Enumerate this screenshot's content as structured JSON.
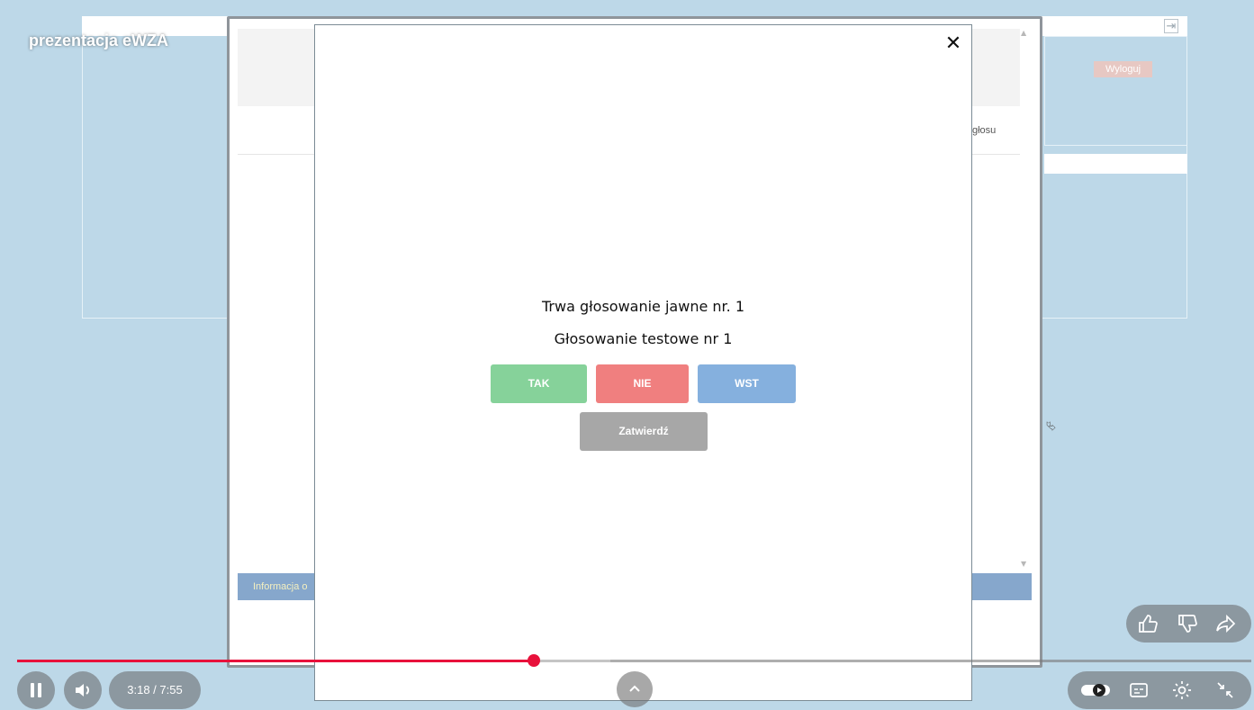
{
  "video": {
    "title": "prezentacja eWZA",
    "time": "3:18 / 7:55",
    "progress_fraction": 0.419,
    "buffer_fraction": 0.481,
    "accent_color": "#e8113b"
  },
  "background_app": {
    "logout_label": "Wyloguj",
    "column_fragment": "głosu",
    "info_fragment": "Informacja o"
  },
  "modal": {
    "close_symbol": "✕",
    "line1": "Trwa głosowanie jawne nr. 1",
    "line2": "Głosowanie testowe nr 1",
    "buttons": {
      "yes": "TAK",
      "no": "NIE",
      "abstain": "WST"
    },
    "confirm": "Zatwierdź"
  },
  "icons": {
    "pause": "pause-icon",
    "volume": "volume-icon",
    "expand": "chevron-up-icon",
    "like": "thumb-up-icon",
    "dislike": "thumb-down-icon",
    "share": "share-icon",
    "autoplay": "autoplay-toggle-icon",
    "captions": "captions-icon",
    "settings": "gear-icon",
    "exit_fullscreen": "exit-fullscreen-icon",
    "logout": "logout-icon"
  }
}
